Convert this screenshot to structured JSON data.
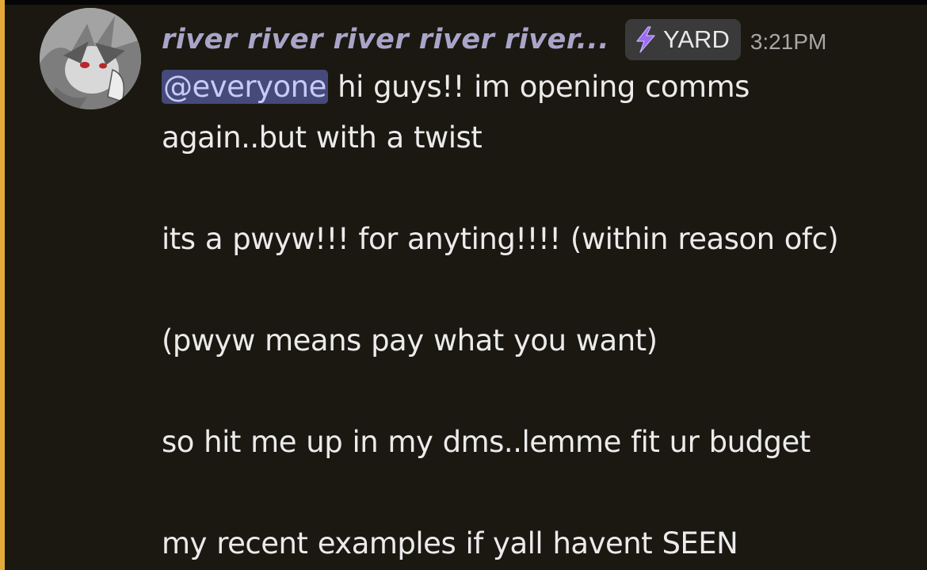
{
  "message": {
    "author": {
      "display_name": "river river river river river...",
      "tag_label": "YARD",
      "tag_icon": "lightning-bolt-icon",
      "name_color": "#a9a5c9"
    },
    "timestamp": "3:21PM",
    "content": {
      "mention": "@everyone",
      "line1_rest": " hi guys!! im opening comms",
      "line2": "again..but with a twist",
      "line3": "its a pwyw!!! for anyting!!!! (within reason ofc)",
      "line4": "(pwyw means pay what you want)",
      "line5": "so hit me up in my dms..lemme fit ur budget",
      "line6": "my recent examples if yall havent SEEN"
    },
    "colors": {
      "background": "#1b1812",
      "mention_highlight_bar": "#e3a93a",
      "mention_pill_bg": "#454a7a",
      "mention_pill_text": "#c7cbf5",
      "tag_bg": "#3a3a3a",
      "tag_icon": "#9b6cf0"
    }
  }
}
